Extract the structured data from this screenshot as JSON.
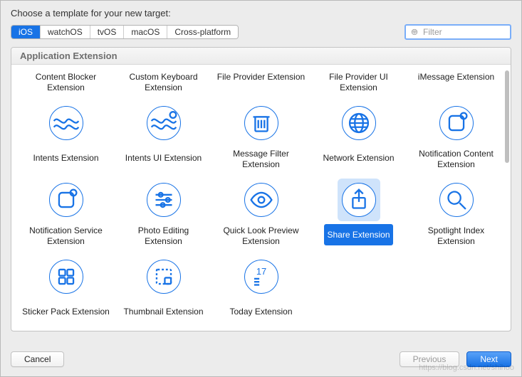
{
  "header": {
    "title": "Choose a template for your new target:"
  },
  "platforms": [
    {
      "label": "iOS",
      "selected": true
    },
    {
      "label": "watchOS",
      "selected": false
    },
    {
      "label": "tvOS",
      "selected": false
    },
    {
      "label": "macOS",
      "selected": false
    },
    {
      "label": "Cross-platform",
      "selected": false
    }
  ],
  "filter": {
    "placeholder": "Filter"
  },
  "section": {
    "title": "Application Extension"
  },
  "templates": [
    {
      "label": "Content Blocker Extension",
      "icon": "waves",
      "selected": false,
      "labelOnly": true
    },
    {
      "label": "Custom Keyboard Extension",
      "icon": "waves",
      "selected": false,
      "labelOnly": true
    },
    {
      "label": "File Provider Extension",
      "icon": "waves",
      "selected": false,
      "labelOnly": true
    },
    {
      "label": "File Provider UI Extension",
      "icon": "waves",
      "selected": false,
      "labelOnly": true
    },
    {
      "label": "iMessage Extension",
      "icon": "waves",
      "selected": false,
      "labelOnly": true
    },
    {
      "label": "Intents Extension",
      "icon": "waves",
      "selected": false
    },
    {
      "label": "Intents UI Extension",
      "icon": "waves-badge",
      "selected": false
    },
    {
      "label": "Message Filter Extension",
      "icon": "trash",
      "selected": false
    },
    {
      "label": "Network Extension",
      "icon": "globe",
      "selected": false
    },
    {
      "label": "Notification Content Extension",
      "icon": "square-badge",
      "selected": false
    },
    {
      "label": "Notification Service Extension",
      "icon": "square-badge",
      "selected": false
    },
    {
      "label": "Photo Editing Extension",
      "icon": "sliders",
      "selected": false
    },
    {
      "label": "Quick Look Preview Extension",
      "icon": "eye",
      "selected": false
    },
    {
      "label": "Share Extension",
      "icon": "share",
      "selected": true
    },
    {
      "label": "Spotlight Index Extension",
      "icon": "search",
      "selected": false
    },
    {
      "label": "Sticker Pack Extension",
      "icon": "grid4",
      "selected": false
    },
    {
      "label": "Thumbnail Extension",
      "icon": "thumb",
      "selected": false
    },
    {
      "label": "Today Extension",
      "icon": "calendar17",
      "selected": false
    }
  ],
  "footer": {
    "cancel": "Cancel",
    "previous": "Previous",
    "next": "Next"
  },
  "watermark": "https://blog.csdn.net/shihoo"
}
